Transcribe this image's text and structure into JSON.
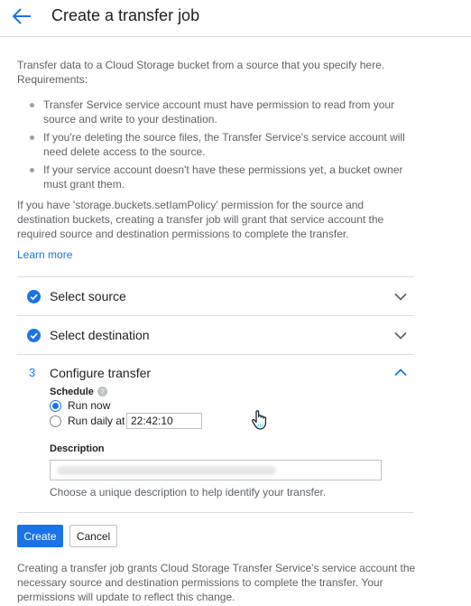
{
  "header": {
    "title": "Create a transfer job"
  },
  "intro": {
    "text": "Transfer data to a Cloud Storage bucket from a source that you specify here. Requirements:",
    "requirements": [
      "Transfer Service service account must have permission to read from your source and write to your destination.",
      "If you're deleting the source files, the Transfer Service's service account will need delete access to the source.",
      "If your service account doesn't have these permissions yet, a bucket owner must grant them."
    ],
    "permission_note": "If you have 'storage.buckets.setIamPolicy' permission for the source and destination buckets, creating a transfer job will grant that service account the required source and destination permissions to complete the transfer.",
    "learn_more": "Learn more"
  },
  "steps": {
    "source": {
      "label": "Select source",
      "status": "complete"
    },
    "destination": {
      "label": "Select destination",
      "status": "complete"
    },
    "configure": {
      "number": "3",
      "label": "Configure transfer",
      "status": "expanded"
    }
  },
  "configure": {
    "schedule_label": "Schedule",
    "run_now_label": "Run now",
    "run_now_selected": true,
    "run_daily_label": "Run daily at",
    "run_daily_time": "22:42:10",
    "description_label": "Description",
    "description_hint": "Choose a unique description to help identify your transfer."
  },
  "actions": {
    "create_label": "Create",
    "cancel_label": "Cancel"
  },
  "footer": {
    "text": "Creating a transfer job grants Cloud Storage Transfer Service's service account the necessary source and destination permissions to complete the transfer. Your permissions will update to reflect this change."
  },
  "colors": {
    "accent": "#1a73e8",
    "text_primary": "#202124",
    "text_secondary": "#5f6368",
    "divider": "#dadce0"
  },
  "icons": {
    "back": "arrow-back-icon",
    "check": "check-circle-icon",
    "expand": "chevron-down-icon",
    "collapse": "chevron-up-icon",
    "help": "help-circle-icon",
    "cursor": "hand-pointer-cursor-icon"
  }
}
